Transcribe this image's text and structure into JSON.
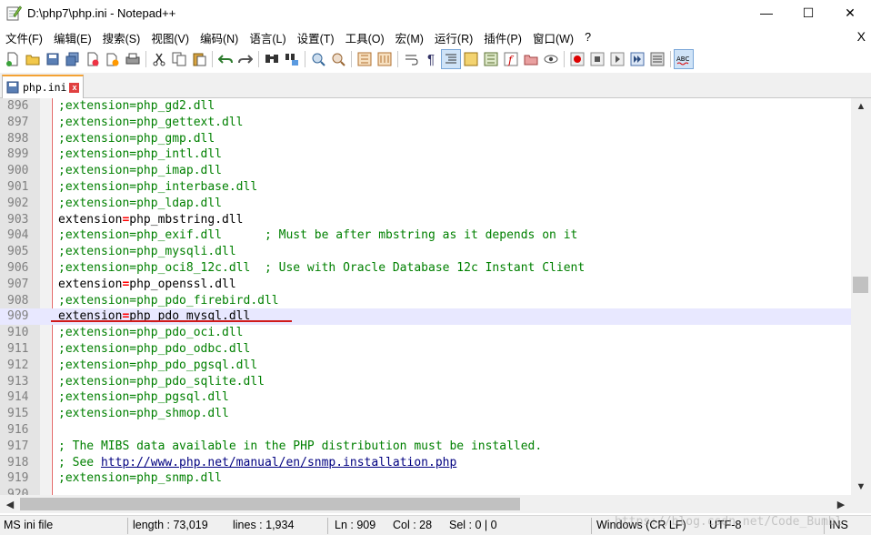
{
  "window": {
    "title": "D:\\php7\\php.ini - Notepad++",
    "minimize": "—",
    "maximize": "☐",
    "close": "✕"
  },
  "menu": {
    "items": [
      "文件(F)",
      "编辑(E)",
      "搜索(S)",
      "视图(V)",
      "编码(N)",
      "语言(L)",
      "设置(T)",
      "工具(O)",
      "宏(M)",
      "运行(R)",
      "插件(P)",
      "窗口(W)",
      "?"
    ],
    "close_doc": "X"
  },
  "tab": {
    "label": "php.ini",
    "close": "x"
  },
  "editor": {
    "current_line": 909,
    "lines": [
      {
        "n": "896",
        "type": "comment",
        "text": ";extension=php_gd2.dll"
      },
      {
        "n": "897",
        "type": "comment",
        "text": ";extension=php_gettext.dll"
      },
      {
        "n": "898",
        "type": "comment",
        "text": ";extension=php_gmp.dll"
      },
      {
        "n": "899",
        "type": "comment",
        "text": ";extension=php_intl.dll"
      },
      {
        "n": "900",
        "type": "comment",
        "text": ";extension=php_imap.dll"
      },
      {
        "n": "901",
        "type": "comment",
        "text": ";extension=php_interbase.dll"
      },
      {
        "n": "902",
        "type": "comment",
        "text": ";extension=php_ldap.dll"
      },
      {
        "n": "903",
        "type": "kv",
        "key": "extension",
        "value": "php_mbstring.dll"
      },
      {
        "n": "904",
        "type": "comment",
        "text": ";extension=php_exif.dll      ; Must be after mbstring as it depends on it"
      },
      {
        "n": "905",
        "type": "comment",
        "text": ";extension=php_mysqli.dll"
      },
      {
        "n": "906",
        "type": "comment",
        "text": ";extension=php_oci8_12c.dll  ; Use with Oracle Database 12c Instant Client"
      },
      {
        "n": "907",
        "type": "kv",
        "key": "extension",
        "value": "php_openssl.dll"
      },
      {
        "n": "908",
        "type": "comment",
        "text": ";extension=php_pdo_firebird.dll"
      },
      {
        "n": "909",
        "type": "kv",
        "key": "extension",
        "value": "php_pdo_mysql.dll"
      },
      {
        "n": "910",
        "type": "comment",
        "text": ";extension=php_pdo_oci.dll"
      },
      {
        "n": "911",
        "type": "comment",
        "text": ";extension=php_pdo_odbc.dll"
      },
      {
        "n": "912",
        "type": "comment",
        "text": ";extension=php_pdo_pgsql.dll"
      },
      {
        "n": "913",
        "type": "comment",
        "text": ";extension=php_pdo_sqlite.dll"
      },
      {
        "n": "914",
        "type": "comment",
        "text": ";extension=php_pgsql.dll"
      },
      {
        "n": "915",
        "type": "comment",
        "text": ";extension=php_shmop.dll"
      },
      {
        "n": "916",
        "type": "blank",
        "text": ""
      },
      {
        "n": "917",
        "type": "comment",
        "text": "; The MIBS data available in the PHP distribution must be installed."
      },
      {
        "n": "918",
        "type": "link",
        "prefix": "; See ",
        "link": "http://www.php.net/manual/en/snmp.installation.php"
      },
      {
        "n": "919",
        "type": "comment",
        "text": ";extension=php_snmp.dll"
      },
      {
        "n": "920",
        "type": "blank",
        "text": ""
      }
    ]
  },
  "status": {
    "file_type": "MS ini file",
    "length": "length : 73,019",
    "lines": "lines : 1,934",
    "ln": "Ln : 909",
    "col": "Col : 28",
    "sel": "Sel : 0 | 0",
    "eol": "Windows (CR LF)",
    "encoding": "UTF-8",
    "mode": "INS"
  },
  "watermark": "https://blog.csdn.net/Code_Bumbl",
  "colors": {
    "comment": "#008000",
    "operator": "#ff0000",
    "current_line_bg": "#e8e8ff",
    "annotation_underline": "#d01a1a"
  },
  "toolbar_icons": [
    "new-file-icon",
    "open-file-icon",
    "save-icon",
    "save-all-icon",
    "close-icon",
    "close-all-icon",
    "print-icon",
    "cut-icon",
    "copy-icon",
    "paste-icon",
    "undo-icon",
    "redo-icon",
    "find-icon",
    "replace-icon",
    "zoom-in-icon",
    "zoom-out-icon",
    "sync-v-icon",
    "sync-h-icon",
    "word-wrap-icon",
    "show-all-chars-icon",
    "indent-guide-icon",
    "doc-map-icon",
    "function-list-icon",
    "folder-workspace-icon",
    "monitor-icon",
    "record-macro-icon",
    "stop-macro-icon",
    "play-macro-icon",
    "run-macro-multiple-icon",
    "save-macro-icon",
    "spell-check-icon"
  ]
}
